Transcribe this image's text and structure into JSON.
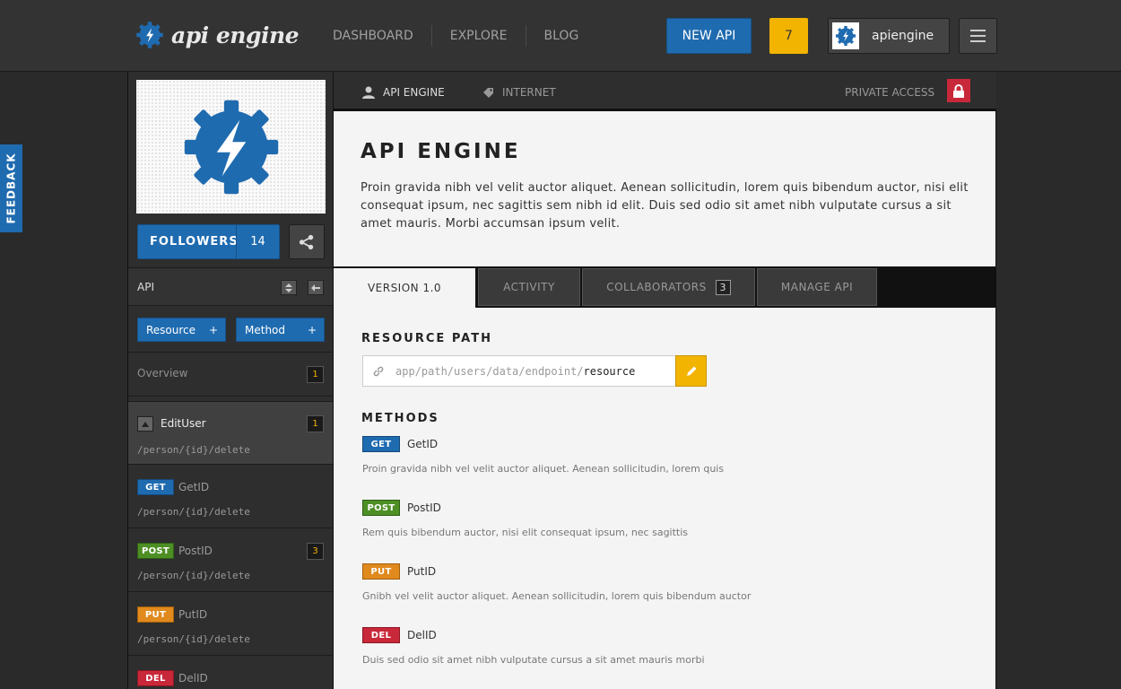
{
  "header": {
    "logo_text": "api engine",
    "nav": [
      "DASHBOARD",
      "EXPLORE",
      "BLOG"
    ],
    "new_api_label": "NEW API",
    "notification_count": "7",
    "username": "apiengine"
  },
  "feedback_label": "FEEDBACK",
  "sidebar": {
    "followers_label": "FOLLOWERS",
    "followers_count": "14",
    "api_section_title": "API",
    "add_resource_label": "Resource",
    "add_method_label": "Method",
    "plus": "+",
    "overview_label": "Overview",
    "overview_count": "1",
    "edit_user": {
      "name": "EditUser",
      "count": "1",
      "path": "/person/{id}/delete"
    },
    "methods": [
      {
        "verb": "GET",
        "name": "GetID",
        "path": "/person/{id}/delete",
        "count": ""
      },
      {
        "verb": "POST",
        "name": "PostID",
        "path": "/person/{id}/delete",
        "count": "3"
      },
      {
        "verb": "PUT",
        "name": "PutID",
        "path": "/person/{id}/delete",
        "count": ""
      },
      {
        "verb": "DEL",
        "name": "DelID",
        "path": "",
        "count": ""
      }
    ]
  },
  "main": {
    "owner_label": "API ENGINE",
    "category_label": "INTERNET",
    "access_label": "PRIVATE ACCESS",
    "title": "API ENGINE",
    "description": "Proin gravida nibh vel velit auctor aliquet. Aenean sollicitudin, lorem quis bibendum auctor, nisi elit consequat ipsum, nec sagittis sem nibh id elit. Duis sed odio sit amet nibh vulputate cursus a sit amet mauris. Morbi accumsan ipsum velit.",
    "tabs": [
      {
        "label": "VERSION 1.0"
      },
      {
        "label": "ACTIVITY"
      },
      {
        "label": "COLLABORATORS",
        "count": "3"
      },
      {
        "label": "MANAGE API"
      }
    ],
    "resource_path_heading": "RESOURCE PATH",
    "resource_path_prefix": "app/path/users/data/endpoint/",
    "resource_path_value": "resource",
    "methods_heading": "METHODS",
    "methods": [
      {
        "verb": "GET",
        "name": "GetID",
        "description": "Proin gravida nibh vel velit auctor aliquet. Aenean sollicitudin, lorem quis"
      },
      {
        "verb": "POST",
        "name": "PostID",
        "description": "Rem quis bibendum auctor, nisi elit consequat ipsum, nec sagittis"
      },
      {
        "verb": "PUT",
        "name": "PutID",
        "description": "Gnibh vel velit auctor aliquet. Aenean sollicitudin, lorem quis bibendum auctor"
      },
      {
        "verb": "DEL",
        "name": "DelID",
        "description": "Duis sed odio sit amet nibh vulputate cursus a sit amet mauris morbi"
      }
    ]
  },
  "colors": {
    "brand_blue": "#1f6bb0",
    "accent_yellow": "#f2b400",
    "get": "#1f6bb0",
    "post": "#4d8f25",
    "put": "#e08a1e",
    "del": "#c9283a"
  },
  "icons": [
    "gear-bolt-logo-icon",
    "share-icon",
    "user-icon",
    "tag-icon",
    "lock-icon",
    "link-icon",
    "pencil-icon",
    "hamburger-icon",
    "sort-arrows-icon",
    "collapse-left-icon",
    "collapse-up-icon"
  ]
}
